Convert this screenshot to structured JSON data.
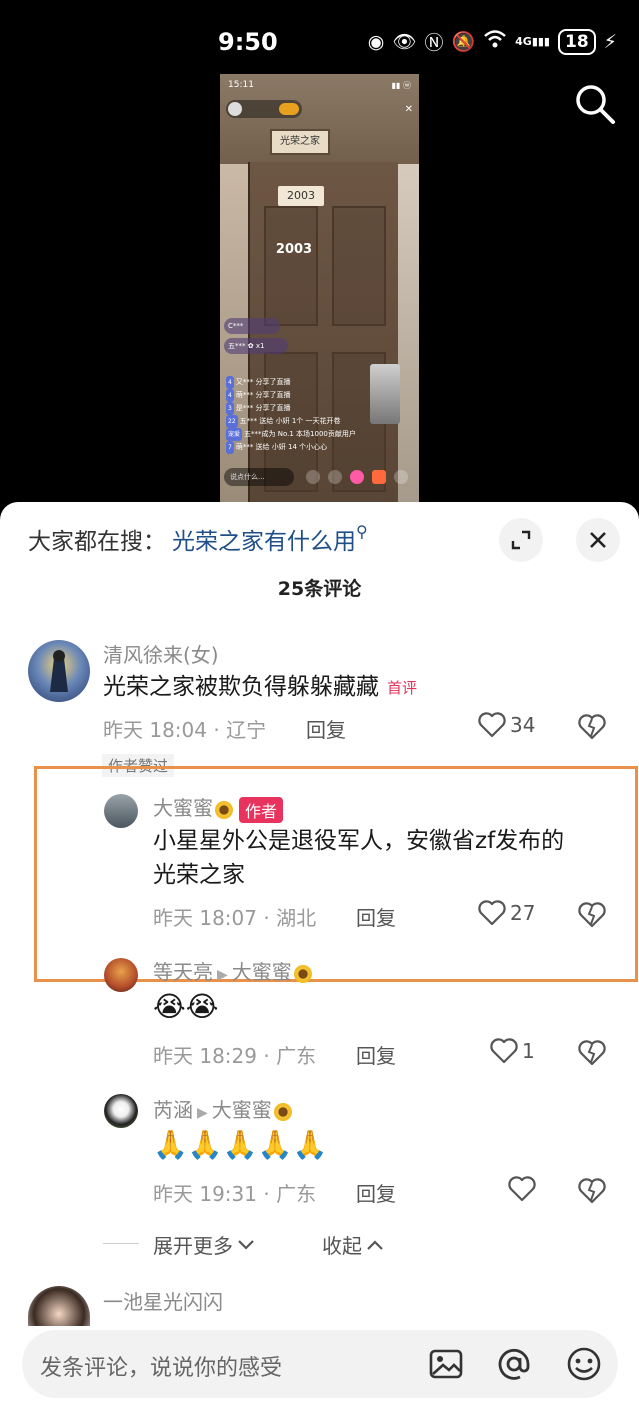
{
  "status_bar": {
    "time": "9:50",
    "network": "4G",
    "battery": "18"
  },
  "video": {
    "time": "15:11",
    "plate_text": "光荣之家",
    "door_number": "2003",
    "door_number_big": "2003",
    "chat": [
      {
        "tag": "4",
        "text": "又*** 分享了直播"
      },
      {
        "tag": "4",
        "text": "萌*** 分享了直播"
      },
      {
        "tag": "3",
        "text": "是*** 分享了直播"
      },
      {
        "tag": "22",
        "text": "五*** 送给 小妍 1个 一天花开卷"
      },
      {
        "tag": "宠爱",
        "text": "五***成为 No.1 本场1000贡献用户"
      },
      {
        "tag": "7",
        "text": "萌*** 送给 小妍 14 个小心心"
      }
    ],
    "input_placeholder": "说点什么..."
  },
  "sheet": {
    "search_label": "大家都在搜：",
    "search_query": "光荣之家有什么用",
    "comment_count": "25条评论",
    "comments": [
      {
        "user": "清风徐来(女)",
        "text": "光荣之家被欺负得躲躲藏藏",
        "badge": "首评",
        "time": "昨天 18:04 · 辽宁",
        "reply": "回复",
        "likes": "34"
      }
    ],
    "author_liked": "作者赞过",
    "replies": [
      {
        "user": "大蜜蜜",
        "badge": "作者",
        "text_line1": "小星星外公是退役军人，安徽省zf发布的",
        "text_line2": "光荣之家",
        "time": "昨天 18:07 · 湖北",
        "reply": "回复",
        "likes": "27"
      },
      {
        "user": "等天亮",
        "reply_to": "大蜜蜜",
        "text": "😭😭",
        "time": "昨天 18:29 · 广东",
        "reply": "回复",
        "likes": "1"
      },
      {
        "user": "芮涵",
        "reply_to": "大蜜蜜",
        "text": "🙏🙏🙏🙏🙏",
        "time": "昨天 19:31 · 广东",
        "reply": "回复",
        "likes": ""
      }
    ],
    "expand_more": "展开更多",
    "collapse": "收起",
    "next_user": "一池星光闪闪",
    "input_placeholder": "发条评论，说说你的感受"
  }
}
